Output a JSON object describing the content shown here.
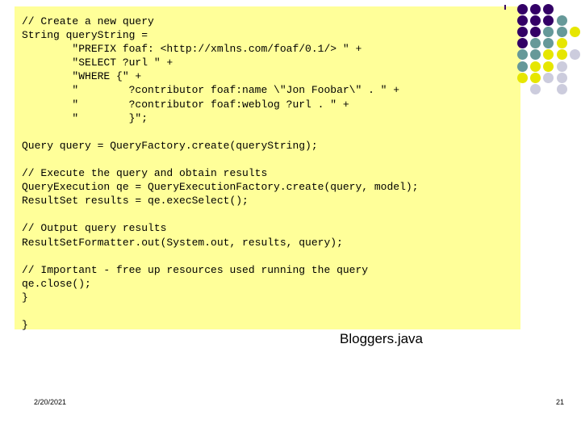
{
  "slide": {
    "caption": "Bloggers.java",
    "code_block": {
      "background_color": "#ffff99",
      "language": "java",
      "code": "// Create a new query\nString queryString =\n        \"PREFIX foaf: <http://xmlns.com/foaf/0.1/> \" +\n        \"SELECT ?url \" +\n        \"WHERE {\" +\n        \"        ?contributor foaf:name \\\"Jon Foobar\\\" . \" +\n        \"        ?contributor foaf:weblog ?url . \" +\n        \"        }\";\n\nQuery query = QueryFactory.create(queryString);\n\n// Execute the query and obtain results\nQueryExecution qe = QueryExecutionFactory.create(query, model);\nResultSet results = qe.execSelect();\n\n// Output query results\nResultSetFormatter.out(System.out, results, query);\n\n// Important - free up resources used running the query\nqe.close();\n}\n\n}"
    },
    "footer": {
      "date": "2/20/2021",
      "page_number": "21"
    },
    "decoration": {
      "dot_grid_name": "dot-grid-decoration",
      "colors": {
        "purple": "#330066",
        "teal": "#669999",
        "yellow": "#e6e600",
        "lavender": "#ccccdd"
      },
      "rows": [
        [
          "purple",
          "purple",
          "purple",
          null,
          null
        ],
        [
          "purple",
          "purple",
          "purple",
          "teal",
          null
        ],
        [
          "purple",
          "purple",
          "teal",
          "teal",
          "yellow"
        ],
        [
          "purple",
          "teal",
          "teal",
          "yellow",
          null
        ],
        [
          "teal",
          "teal",
          "yellow",
          "yellow",
          "lavender"
        ],
        [
          "teal",
          "yellow",
          "yellow",
          "lavender",
          null
        ],
        [
          "yellow",
          "yellow",
          "lavender",
          "lavender",
          null
        ],
        [
          null,
          "lavender",
          null,
          "lavender",
          null
        ]
      ]
    }
  }
}
